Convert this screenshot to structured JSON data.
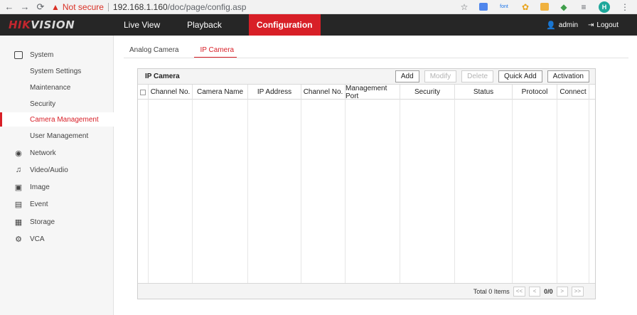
{
  "browser": {
    "back": "←",
    "forward": "→",
    "reload": "C",
    "not_secure": "Not secure",
    "url_host": "192.168.1.160",
    "url_path": "/doc/page/config.asp",
    "ext_font": "font",
    "avatar": "H"
  },
  "header": {
    "logo_red": "HIK",
    "logo_gray": "VISION",
    "nav": [
      "Live View",
      "Playback",
      "Configuration"
    ],
    "user": "admin",
    "logout": "Logout"
  },
  "sidebar": {
    "items": [
      {
        "label": "System",
        "icon": "monitor-icon"
      },
      {
        "label": "System Settings"
      },
      {
        "label": "Maintenance"
      },
      {
        "label": "Security"
      },
      {
        "label": "Camera Management"
      },
      {
        "label": "User Management"
      },
      {
        "label": "Network",
        "icon": "globe-icon"
      },
      {
        "label": "Video/Audio",
        "icon": "video-audio-icon"
      },
      {
        "label": "Image",
        "icon": "image-icon"
      },
      {
        "label": "Event",
        "icon": "event-icon"
      },
      {
        "label": "Storage",
        "icon": "storage-icon"
      },
      {
        "label": "VCA",
        "icon": "vca-icon"
      }
    ]
  },
  "tabs": [
    "Analog Camera",
    "IP Camera"
  ],
  "panel": {
    "title": "IP Camera",
    "buttons": [
      "Add",
      "Modify",
      "Delete",
      "Quick Add",
      "Activation"
    ],
    "columns": [
      "Channel No.",
      "Camera Name",
      "IP Address",
      "Channel No.",
      "Management Port",
      "Security",
      "Status",
      "Protocol",
      "Connect"
    ]
  },
  "pager": {
    "total": "Total 0 Items",
    "first": "<<",
    "prev": "<",
    "page": "0/0",
    "next": ">",
    "last": ">>"
  }
}
